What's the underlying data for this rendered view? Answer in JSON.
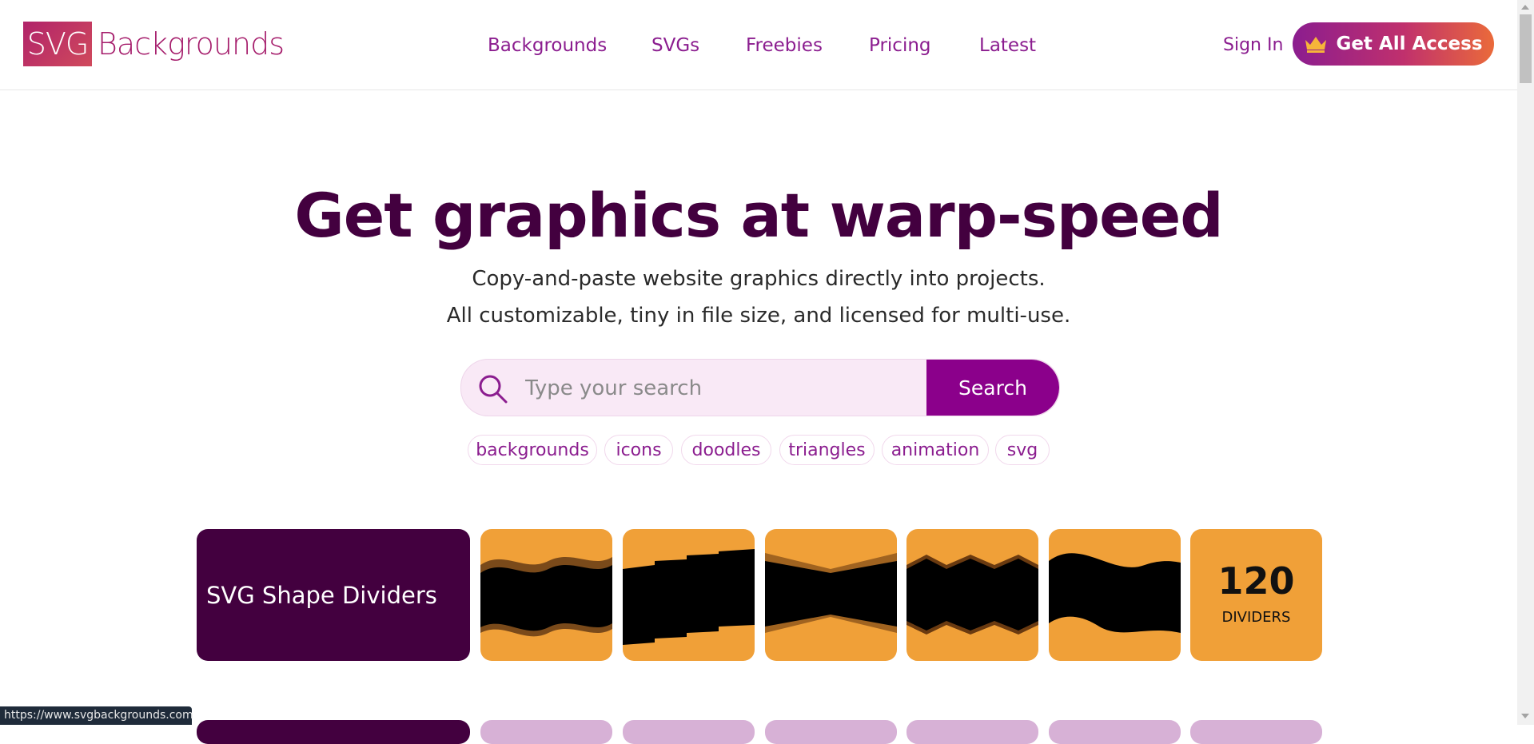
{
  "brand": {
    "logo_mark": "SVG",
    "logo_text": "Backgrounds"
  },
  "nav": {
    "items": [
      "Backgrounds",
      "SVGs",
      "Freebies",
      "Pricing",
      "Latest"
    ]
  },
  "header": {
    "signin_label": "Sign In",
    "cta_label": "Get All Access",
    "cta_icon": "crown-icon"
  },
  "hero": {
    "title": "Get graphics at warp-speed",
    "subtitle_line1": "Copy-and-paste website graphics directly into projects.",
    "subtitle_line2": "All customizable, tiny in file size, and licensed for multi-use."
  },
  "search": {
    "placeholder": "Type your search",
    "value": "",
    "button_label": "Search",
    "icon": "search-icon"
  },
  "tags": [
    "backgrounds",
    "icons",
    "doodles",
    "triangles",
    "animation",
    "svg"
  ],
  "collection": {
    "title": "SVG Shape Dividers",
    "count": "120",
    "count_label": "DIVIDERS"
  },
  "statusbar": {
    "url": "https://www.svgbackgrounds.com"
  },
  "colors": {
    "brand_dark": "#43003f",
    "brand_purple": "#8b008b",
    "accent_orange": "#f0a038",
    "search_bg": "#f9e9f6"
  }
}
